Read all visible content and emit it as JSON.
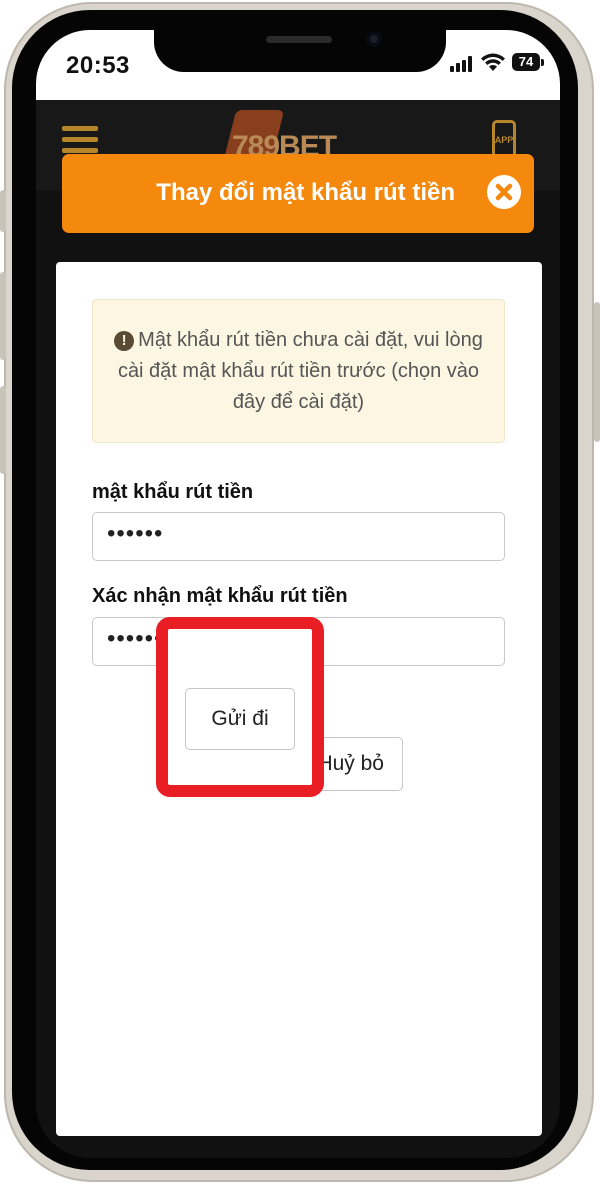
{
  "status_bar": {
    "time": "20:53",
    "battery": "74"
  },
  "site_header": {
    "logo_text": "789BET",
    "app_label": "APP"
  },
  "modal": {
    "title": "Thay đổi mật khẩu rút tiền",
    "warning": {
      "icon": "exclamation-circle-icon",
      "text": "Mật khẩu rút tiền chưa cài đặt, vui lòng cài đặt mật khẩu rút tiền trước (chọn vào đây để cài đặt)"
    },
    "fields": [
      {
        "label": "mật khẩu rút tiền",
        "value": "••••••"
      },
      {
        "label": "Xác nhận mật khẩu rút tiền",
        "value": "••••••"
      }
    ],
    "buttons": {
      "submit": "Gửi đi",
      "cancel": "Huỷ bỏ"
    }
  },
  "colors": {
    "accent_orange": "#f5890d",
    "highlight_red": "#e91d24",
    "warning_bg": "#fcf6e3"
  }
}
